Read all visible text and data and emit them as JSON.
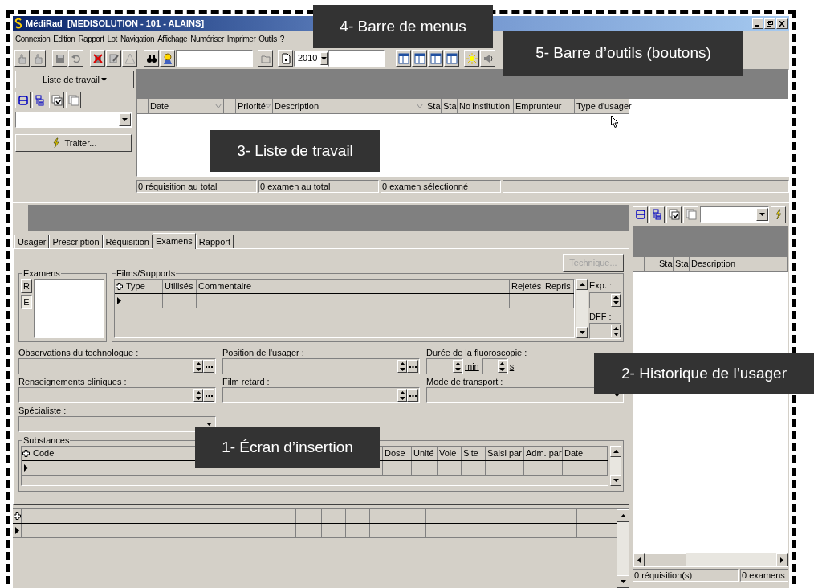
{
  "window": {
    "title": "MédiRad  [MEDISOLUTION - 101 - ALAINS]"
  },
  "menu": [
    "Connexion",
    "Edition",
    "Rapport",
    "Lot",
    "Navigation",
    "Affichage",
    "Numériser",
    "Imprimer",
    "Outils",
    "?"
  ],
  "toolbar": {
    "year": "2010"
  },
  "worklist_panel": {
    "menu_button": "Liste de travail",
    "process_button": "Traiter..."
  },
  "worklist": {
    "columns": [
      {
        "sort": false
      },
      {
        "label": "Date",
        "sort": true
      },
      {
        "sort": false
      },
      {
        "label": "Priorité",
        "sort": true
      },
      {
        "label": "Description",
        "sort": true
      },
      {
        "label": "Sta"
      },
      {
        "label": "Sta"
      },
      {
        "label": "No"
      },
      {
        "label": "Institution"
      },
      {
        "label": "Emprunteur",
        "sort": false
      },
      {
        "label": "Type d'usager"
      }
    ],
    "status_bar": [
      "0 réquisition au total",
      "0 examen au total",
      "0 examen sélectionné"
    ]
  },
  "editor": {
    "tabs": [
      {
        "label": "Usager",
        "selected": false
      },
      {
        "label": "Prescription",
        "selected": false
      },
      {
        "label": "Réquisition",
        "selected": false
      },
      {
        "label": "Examens",
        "selected": true
      },
      {
        "label": "Rapport",
        "selected": false
      }
    ],
    "technique_button": {
      "label": "Technique...",
      "disabled": true
    },
    "exams_group": {
      "legend": "Examens",
      "buttons": [
        {
          "label": "R",
          "selected": false
        },
        {
          "label": "E",
          "selected": true
        }
      ]
    },
    "films_group": {
      "legend": "Films/Supports",
      "columns": [
        "Type",
        "Utilisés",
        "Commentaire",
        "Rejetés",
        "Repris"
      ],
      "exp_label": "Exp. :",
      "dff_label": "DFF :"
    },
    "fields": [
      {
        "kind": "memo",
        "label": "Observations du technologue :"
      },
      {
        "kind": "memo",
        "label": "Position de l'usager :"
      },
      {
        "kind": "duration",
        "label": "Durée de la fluoroscopie :",
        "min_unit": "min",
        "sec_unit": "s"
      },
      {
        "kind": "memo",
        "label": "Renseignements cliniques :"
      },
      {
        "kind": "memo",
        "label": "Film retard :"
      },
      {
        "kind": "combo",
        "label": "Mode de transport :"
      },
      {
        "kind": "combo",
        "label": "Spécialiste :"
      }
    ],
    "substances": {
      "legend": "Substances",
      "columns": [
        "Code",
        "Dose",
        "Unité",
        "Voie",
        "Site",
        "Saisi par",
        "Adm. par",
        "Date"
      ]
    }
  },
  "history": {
    "columns": [
      "Sta",
      "Sta",
      "Description"
    ],
    "status_bar": [
      "0 réquisition(s)",
      "0 examens"
    ]
  },
  "callouts": [
    {
      "text": "4- Barre de menus"
    },
    {
      "text": "5- Barre d’outils (boutons)"
    },
    {
      "text": "3- Liste de travail"
    },
    {
      "text": "2- Historique de l’usager"
    },
    {
      "text": "1- Écran d’insertion"
    }
  ]
}
